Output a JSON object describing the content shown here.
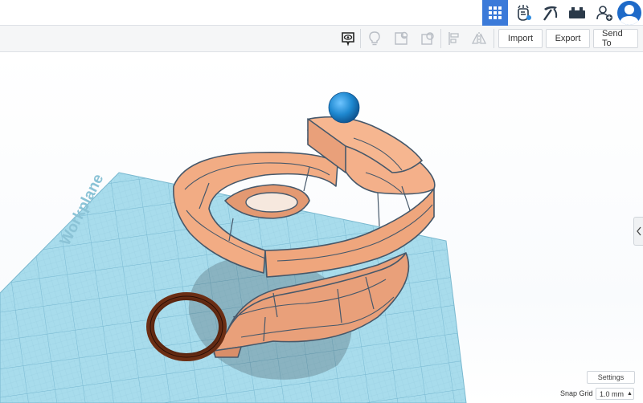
{
  "topbar": {
    "icons": [
      "grid-view-icon",
      "blocks-icon",
      "pickaxe-icon",
      "brick-icon",
      "add-user-icon",
      "avatar-icon"
    ]
  },
  "toolbar": {
    "import_label": "Import",
    "export_label": "Export",
    "sendto_label": "Send To"
  },
  "workspace": {
    "workplane_label": "Workplane",
    "settings_label": "Settings",
    "snap_grid_label": "Snap Grid",
    "snap_grid_value": "1.0 mm"
  },
  "colors": {
    "accent": "#3b7ad9",
    "workplane": "#a8dcec",
    "shape": "#f2ac84",
    "ball": "#1e88d0",
    "ring": "#4a1e0e"
  }
}
